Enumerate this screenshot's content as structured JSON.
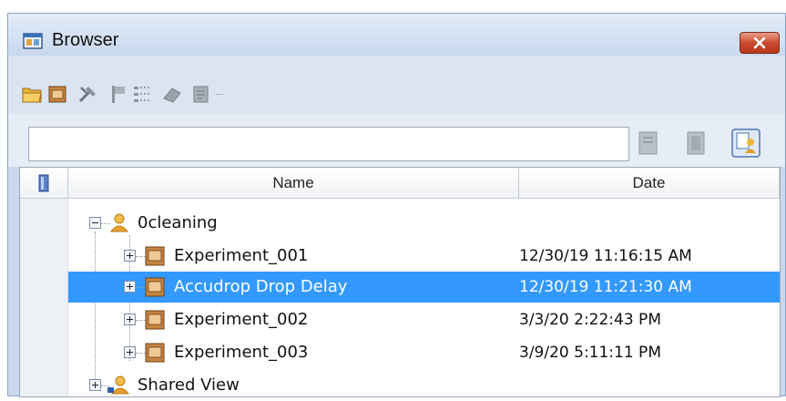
{
  "window": {
    "title": "Browser"
  },
  "toolbar": {
    "icons": [
      "open-folder-icon",
      "experiment-icon",
      "tools-icon",
      "flag-icon",
      "tree-icon",
      "eraser-icon",
      "document-icon"
    ]
  },
  "search": {
    "value": "",
    "placeholder": ""
  },
  "search_buttons": [
    "filter-icon",
    "page-icon",
    "user-search-icon"
  ],
  "columns": {
    "name": "Name",
    "date": "Date"
  },
  "tree": {
    "root": {
      "label": "0cleaning"
    },
    "items": [
      {
        "label": "Experiment_001",
        "date": "12/30/19 11:16:15 AM",
        "selected": false
      },
      {
        "label": "Accudrop Drop Delay",
        "date": "12/30/19 11:21:30 AM",
        "selected": true
      },
      {
        "label": "Experiment_002",
        "date": "3/3/20 2:22:43 PM",
        "selected": false
      },
      {
        "label": "Experiment_003",
        "date": "3/9/20 5:11:11 PM",
        "selected": false
      }
    ],
    "shared": {
      "label": "Shared View"
    }
  },
  "colors": {
    "selection": "#3399ff",
    "title_bar": "#c8d8ee",
    "close_button": "#c94a2e"
  }
}
